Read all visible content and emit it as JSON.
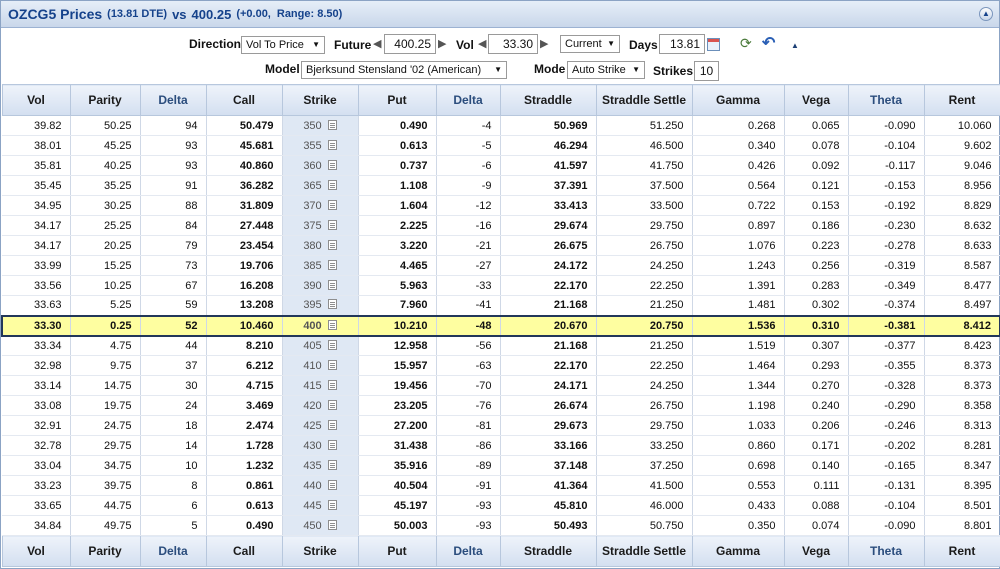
{
  "title": {
    "symbol_prices": "OZCG5 Prices",
    "dte": "(13.81 DTE)",
    "vs": "vs",
    "price": "400.25",
    "change": "(+0.00,",
    "range": "Range: 8.50)"
  },
  "controls": {
    "direction_label": "Direction",
    "direction_value": "Vol To Price",
    "future_label": "Future",
    "future_value": "400.25",
    "vol_label": "Vol",
    "vol_value": "33.30",
    "vol_mode_value": "Current",
    "days_label": "Days",
    "days_value": "13.81",
    "model_label": "Model",
    "model_value": "Bjerksund Stensland '02 (American)",
    "mode_label": "Mode",
    "mode_value": "Auto Strike",
    "strikes_label": "Strikes",
    "strikes_value": "10"
  },
  "icons": {
    "collapse": "collapse-icon",
    "calendar": "calendar-icon",
    "refresh": "refresh-icon",
    "undo": "undo-icon",
    "sheet": "sheet-icon"
  },
  "columns": [
    "Vol",
    "Parity",
    "Delta",
    "Call",
    "Strike",
    "Put",
    "Delta",
    "Straddle",
    "Straddle Settle",
    "Gamma",
    "Vega",
    "Theta",
    "Rent"
  ],
  "rows": [
    [
      "39.82",
      "50.25",
      "94",
      "50.479",
      "350",
      "0.490",
      "-4",
      "50.969",
      "51.250",
      "0.268",
      "0.065",
      "-0.090",
      "10.060"
    ],
    [
      "38.01",
      "45.25",
      "93",
      "45.681",
      "355",
      "0.613",
      "-5",
      "46.294",
      "46.500",
      "0.340",
      "0.078",
      "-0.104",
      "9.602"
    ],
    [
      "35.81",
      "40.25",
      "93",
      "40.860",
      "360",
      "0.737",
      "-6",
      "41.597",
      "41.750",
      "0.426",
      "0.092",
      "-0.117",
      "9.046"
    ],
    [
      "35.45",
      "35.25",
      "91",
      "36.282",
      "365",
      "1.108",
      "-9",
      "37.391",
      "37.500",
      "0.564",
      "0.121",
      "-0.153",
      "8.956"
    ],
    [
      "34.95",
      "30.25",
      "88",
      "31.809",
      "370",
      "1.604",
      "-12",
      "33.413",
      "33.500",
      "0.722",
      "0.153",
      "-0.192",
      "8.829"
    ],
    [
      "34.17",
      "25.25",
      "84",
      "27.448",
      "375",
      "2.225",
      "-16",
      "29.674",
      "29.750",
      "0.897",
      "0.186",
      "-0.230",
      "8.632"
    ],
    [
      "34.17",
      "20.25",
      "79",
      "23.454",
      "380",
      "3.220",
      "-21",
      "26.675",
      "26.750",
      "1.076",
      "0.223",
      "-0.278",
      "8.633"
    ],
    [
      "33.99",
      "15.25",
      "73",
      "19.706",
      "385",
      "4.465",
      "-27",
      "24.172",
      "24.250",
      "1.243",
      "0.256",
      "-0.319",
      "8.587"
    ],
    [
      "33.56",
      "10.25",
      "67",
      "16.208",
      "390",
      "5.963",
      "-33",
      "22.170",
      "22.250",
      "1.391",
      "0.283",
      "-0.349",
      "8.477"
    ],
    [
      "33.63",
      "5.25",
      "59",
      "13.208",
      "395",
      "7.960",
      "-41",
      "21.168",
      "21.250",
      "1.481",
      "0.302",
      "-0.374",
      "8.497"
    ],
    [
      "33.30",
      "0.25",
      "52",
      "10.460",
      "400",
      "10.210",
      "-48",
      "20.670",
      "20.750",
      "1.536",
      "0.310",
      "-0.381",
      "8.412"
    ],
    [
      "33.34",
      "4.75",
      "44",
      "8.210",
      "405",
      "12.958",
      "-56",
      "21.168",
      "21.250",
      "1.519",
      "0.307",
      "-0.377",
      "8.423"
    ],
    [
      "32.98",
      "9.75",
      "37",
      "6.212",
      "410",
      "15.957",
      "-63",
      "22.170",
      "22.250",
      "1.464",
      "0.293",
      "-0.355",
      "8.373"
    ],
    [
      "33.14",
      "14.75",
      "30",
      "4.715",
      "415",
      "19.456",
      "-70",
      "24.171",
      "24.250",
      "1.344",
      "0.270",
      "-0.328",
      "8.373"
    ],
    [
      "33.08",
      "19.75",
      "24",
      "3.469",
      "420",
      "23.205",
      "-76",
      "26.674",
      "26.750",
      "1.198",
      "0.240",
      "-0.290",
      "8.358"
    ],
    [
      "32.91",
      "24.75",
      "18",
      "2.474",
      "425",
      "27.200",
      "-81",
      "29.673",
      "29.750",
      "1.033",
      "0.206",
      "-0.246",
      "8.313"
    ],
    [
      "32.78",
      "29.75",
      "14",
      "1.728",
      "430",
      "31.438",
      "-86",
      "33.166",
      "33.250",
      "0.860",
      "0.171",
      "-0.202",
      "8.281"
    ],
    [
      "33.04",
      "34.75",
      "10",
      "1.232",
      "435",
      "35.916",
      "-89",
      "37.148",
      "37.250",
      "0.698",
      "0.140",
      "-0.165",
      "8.347"
    ],
    [
      "33.23",
      "39.75",
      "8",
      "0.861",
      "440",
      "40.504",
      "-91",
      "41.364",
      "41.500",
      "0.553",
      "0.111",
      "-0.131",
      "8.395"
    ],
    [
      "33.65",
      "44.75",
      "6",
      "0.613",
      "445",
      "45.197",
      "-93",
      "45.810",
      "46.000",
      "0.433",
      "0.088",
      "-0.104",
      "8.501"
    ],
    [
      "34.84",
      "49.75",
      "5",
      "0.490",
      "450",
      "50.003",
      "-93",
      "50.493",
      "50.750",
      "0.350",
      "0.074",
      "-0.090",
      "8.801"
    ]
  ],
  "atm_strike": "400",
  "colors": {
    "highlight": "#fefea0",
    "title_text": "#15428b",
    "header_bg": "#d3dff0",
    "strike_bg": "#dfe8f4"
  }
}
